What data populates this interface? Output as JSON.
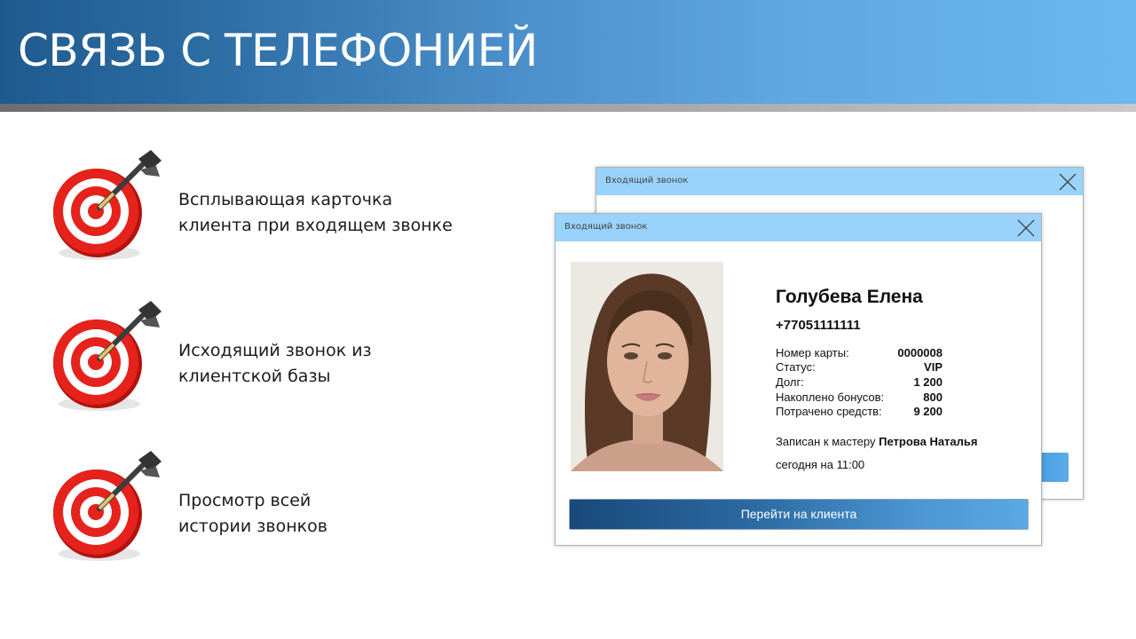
{
  "title": "СВЯЗЬ С ТЕЛЕФОНИЕЙ",
  "features": [
    {
      "line1": "Всплывающая карточка",
      "line2": "клиента при входящем звонке",
      "icon": "target-dart-icon"
    },
    {
      "line1": "Исходящий звонок из",
      "line2": "клиентской базы",
      "icon": "target-dart-icon"
    },
    {
      "line1": "Просмотр всей",
      "line2": "истории звонков",
      "icon": "target-dart-icon"
    }
  ],
  "windows": {
    "back": {
      "title": "Входящий звонок"
    },
    "front": {
      "title": "Входящий звонок"
    }
  },
  "client": {
    "name": "Голубева Елена",
    "phone": "+77051111111",
    "fields": [
      {
        "label": "Номер карты:",
        "value": "0000008"
      },
      {
        "label": "Статус:",
        "value": "VIP"
      },
      {
        "label": "Долг:",
        "value": "1 200"
      },
      {
        "label": "Накоплено бонусов:",
        "value": "800"
      },
      {
        "label": "Потрачено средств:",
        "value": "9 200"
      }
    ],
    "appointment_prefix": "Записан к мастеру",
    "master": "Петрова Наталья",
    "time_prefix": "сегодня на",
    "time": "11:00"
  },
  "button_label": "Перейти на клиента",
  "colors": {
    "header_start": "#1f5a8e",
    "header_end": "#6ab8ef",
    "titlebar": "#99d3fb",
    "target_red": "#e5221b"
  }
}
